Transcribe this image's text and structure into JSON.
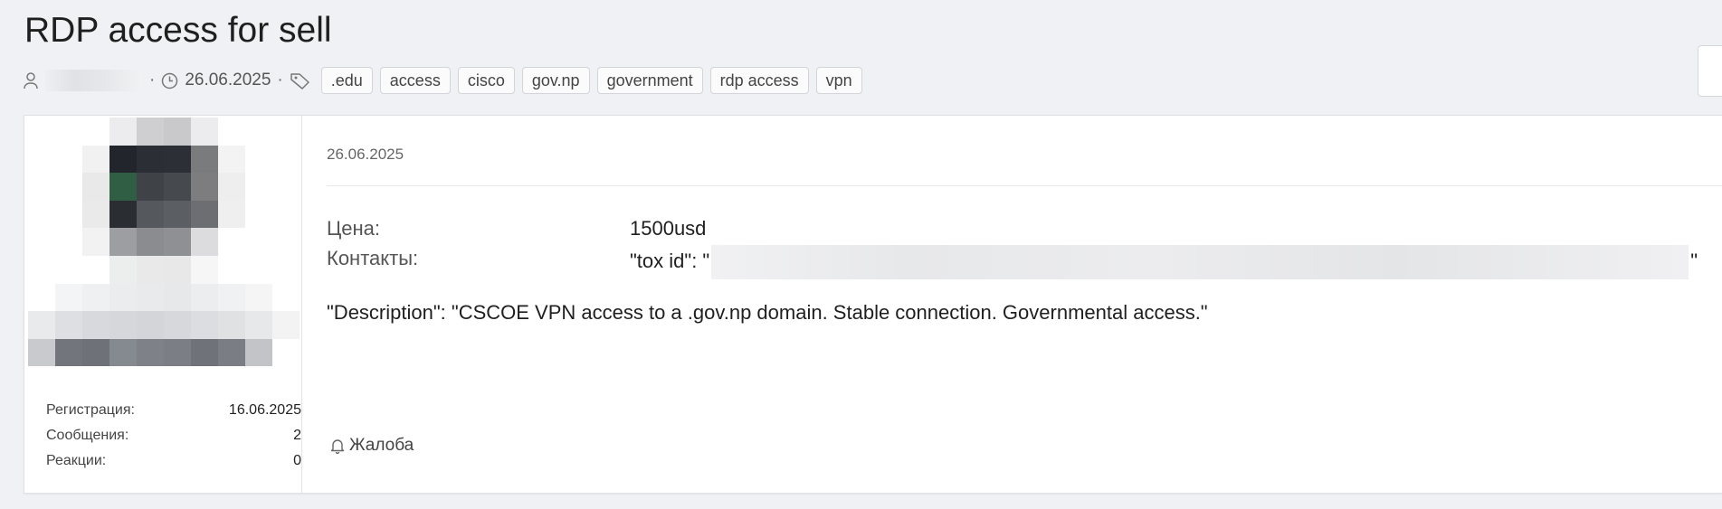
{
  "thread": {
    "title": "RDP access for sell",
    "meta": {
      "separator": "·",
      "date": "26.06.2025",
      "tags": [
        ".edu",
        "access",
        "cisco",
        "gov.np",
        "government",
        "rdp access",
        "vpn"
      ]
    }
  },
  "post": {
    "date": "26.06.2025",
    "fields": {
      "price_label": "Цена:",
      "price_value": "1500usd",
      "contacts_label": "Контакты:",
      "contacts_prefix": "\"tox id\": \"",
      "contacts_suffix": "\""
    },
    "description": "\"Description\": \"CSCOE VPN access to a .gov.np domain. Stable connection. Governmental access.\"",
    "report_label": "Жалоба"
  },
  "user": {
    "stats": [
      {
        "label": "Регистрация:",
        "value": "16.06.2025"
      },
      {
        "label": "Сообщения:",
        "value": "2"
      },
      {
        "label": "Реакции:",
        "value": "0"
      }
    ]
  },
  "icons": {
    "user": "user-icon",
    "clock": "clock-icon",
    "tag": "tag-icon",
    "bell": "bell-icon"
  },
  "colors": {
    "page_background": "#f0f1f4",
    "panel_background": "#ffffff",
    "tag_border": "#d3d5da"
  }
}
